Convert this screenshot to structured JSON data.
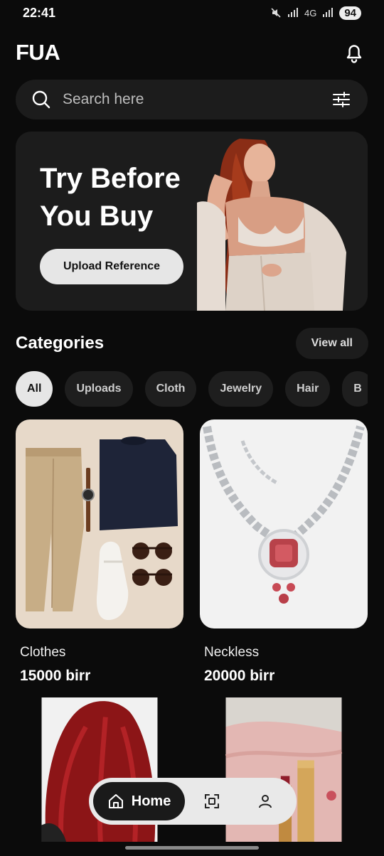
{
  "status_bar": {
    "time": "22:41",
    "network": "4G",
    "battery": "94"
  },
  "header": {
    "brand": "FUA",
    "bell_icon": "bell-icon"
  },
  "search": {
    "placeholder": "Search here",
    "value": "",
    "search_icon": "search-icon",
    "filter_icon": "sliders-icon"
  },
  "hero": {
    "title": "Try Before You Buy",
    "button_label": "Upload Reference"
  },
  "categories": {
    "title": "Categories",
    "view_all_label": "View all",
    "chips": [
      {
        "label": "All",
        "active": true
      },
      {
        "label": "Uploads",
        "active": false
      },
      {
        "label": "Cloth",
        "active": false
      },
      {
        "label": "Jewelry",
        "active": false
      },
      {
        "label": "Hair",
        "active": false
      },
      {
        "label": "B",
        "active": false
      }
    ]
  },
  "products": [
    {
      "name": "Clothes",
      "price": "15000 birr"
    },
    {
      "name": "Neckless",
      "price": "20000 birr"
    },
    {
      "name": "",
      "price": ""
    },
    {
      "name": "",
      "price": ""
    }
  ],
  "bottom_nav": {
    "home_label": "Home",
    "home_icon": "home-icon",
    "scan_icon": "scan-icon",
    "profile_icon": "user-icon"
  },
  "colors": {
    "background": "#0b0b0b",
    "surface": "#1c1c1c",
    "light": "#e6e6e6"
  }
}
